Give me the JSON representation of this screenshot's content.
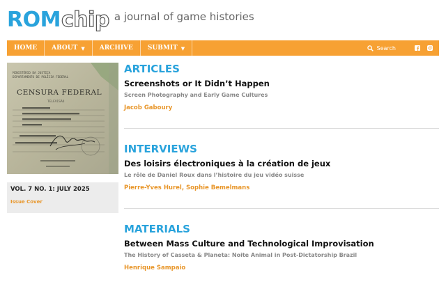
{
  "site": {
    "logo_rom": "ROM",
    "logo_chip": "chip",
    "tagline": "a journal of game histories"
  },
  "nav": {
    "items": [
      {
        "label": "HOME",
        "has_dropdown": false
      },
      {
        "label": "ABOUT",
        "has_dropdown": true
      },
      {
        "label": "ARCHIVE",
        "has_dropdown": false
      },
      {
        "label": "SUBMIT",
        "has_dropdown": true
      }
    ],
    "search_placeholder": "Search",
    "social": [
      "facebook-icon",
      "instagram-icon"
    ],
    "colors": {
      "bar": "#f7a133",
      "text": "#ffffff"
    }
  },
  "issue": {
    "title": "VOL. 7 NO. 1: JULY 2025",
    "cover_link": "Issue Cover",
    "cover_text": {
      "header_small_1": "MINISTÉRIO DA JUSTIÇA",
      "header_small_2": "DEPARTAMENTO DE POLÍCIA FEDERAL",
      "heading": "CENSURA FEDERAL",
      "subheading": "TELEVISÃO"
    }
  },
  "sections": [
    {
      "heading": "ARTICLES",
      "title": "Screenshots or It Didn’t Happen",
      "subtitle": "Screen Photography and Early Game Cultures",
      "authors": "Jacob Gaboury"
    },
    {
      "heading": "INTERVIEWS",
      "title": "Des loisirs électroniques à la création de jeux",
      "subtitle": "Le rôle de Daniel Roux dans l’histoire du jeu vidéo suisse",
      "authors": "Pierre-Yves Hurel, Sophie Bemelmans"
    },
    {
      "heading": "MATERIALS",
      "title": "Between Mass Culture and Technological Improvisation",
      "subtitle": "The History of Casseta & Planeta: Noite Animal in Post-Dictatorship Brazil",
      "authors": "Henrique Sampaio"
    }
  ],
  "colors": {
    "accent_blue": "#29a3dc",
    "accent_orange": "#e8962a",
    "muted_gray": "#888888"
  }
}
